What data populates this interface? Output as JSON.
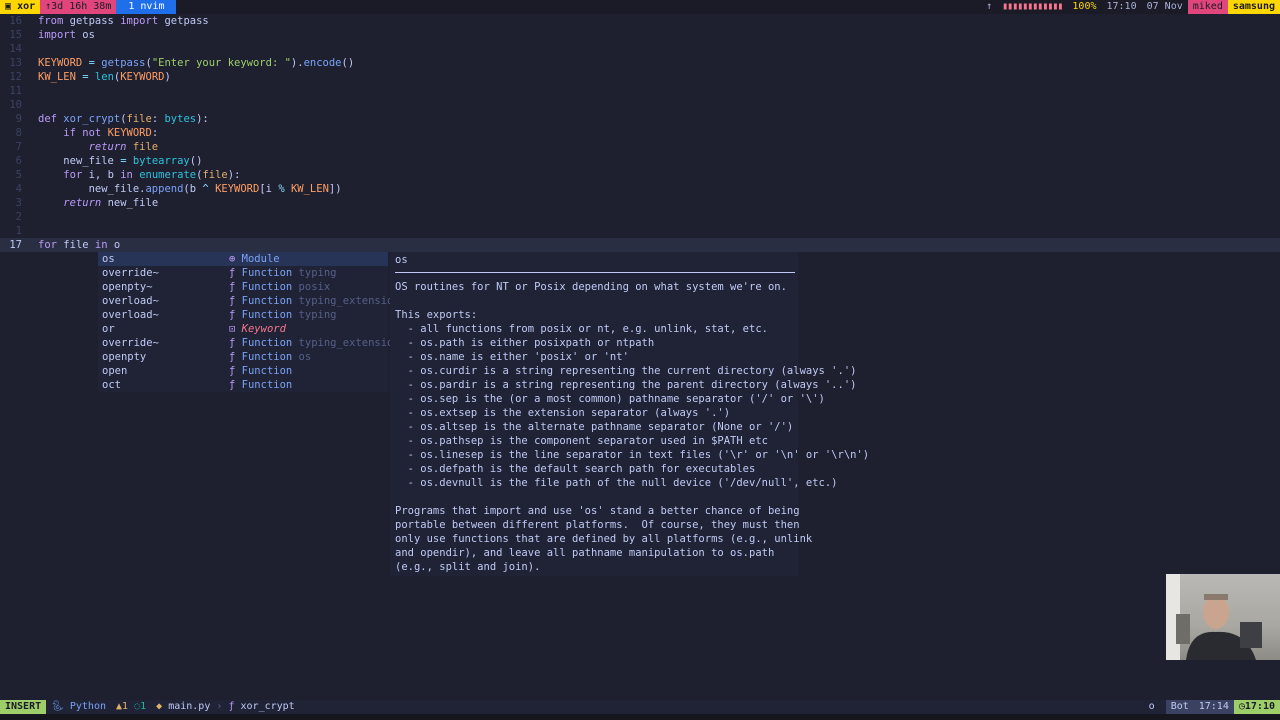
{
  "topbar": {
    "session": "xor",
    "uptime": "↑3d 16h 38m",
    "window": "1 nvim",
    "battery_arrow": "↑",
    "battery_bars": "▮▮▮▮▮▮▮▮▮▮▮▮",
    "battery_pct": "100%",
    "time": "17:10",
    "date": "07 Nov",
    "user": "miked",
    "host": "samsung",
    "colors": {
      "session_bg": "#ffd700",
      "uptime_bg": "#e0457b",
      "window_bg": "#1f6feb",
      "user_bg": "#e0457b",
      "host_bg": "#ffd700"
    }
  },
  "editor": {
    "lines": [
      {
        "num": "16",
        "html": "<span class='kw'>from</span> <span class='var'>getpass</span> <span class='kw'>import</span> <span class='var'>getpass</span>"
      },
      {
        "num": "15",
        "html": "<span class='kw'>import</span> <span class='var'>os</span>"
      },
      {
        "num": "14",
        "html": ""
      },
      {
        "num": "13",
        "html": "<span class='const'>KEYWORD</span> <span class='op'>=</span> <span class='fn'>getpass</span>(<span class='str'>\"Enter your keyword: \"</span>).<span class='fn'>encode</span>()"
      },
      {
        "num": "12",
        "html": "<span class='const'>KW_LEN</span> <span class='op'>=</span> <span class='ty'>len</span>(<span class='const'>KEYWORD</span>)"
      },
      {
        "num": "11",
        "html": ""
      },
      {
        "num": "10",
        "html": ""
      },
      {
        "num": "9",
        "html": "<span class='kw'>def</span> <span class='fn'>xor_crypt</span>(<span class='param'>file</span>: <span class='ty'>bytes</span>):"
      },
      {
        "num": "8",
        "html": "    <span class='kw'>if</span> <span class='kw'>not</span> <span class='const'>KEYWORD</span>:"
      },
      {
        "num": "7",
        "html": "        <span class='kwi'>return</span> <span class='param'>file</span>"
      },
      {
        "num": "6",
        "html": "    <span class='var'>new_file</span> <span class='op'>=</span> <span class='ty'>bytearray</span>()"
      },
      {
        "num": "5",
        "html": "    <span class='kw'>for</span> <span class='var'>i</span>, <span class='var'>b</span> <span class='kw'>in</span> <span class='ty'>enumerate</span>(<span class='param'>file</span>):"
      },
      {
        "num": "4",
        "html": "        <span class='var'>new_file</span>.<span class='fn'>append</span>(<span class='var'>b</span> <span class='op'>^</span> <span class='const'>KEYWORD</span>[<span class='var'>i</span> <span class='op'>%</span> <span class='const'>KW_LEN</span>])"
      },
      {
        "num": "3",
        "html": "    <span class='kwi'>return</span> <span class='var'>new_file</span>"
      },
      {
        "num": "2",
        "html": ""
      },
      {
        "num": "1",
        "html": ""
      },
      {
        "num": "17",
        "html": "<span class='kw'>for</span> <span class='var'>file</span> <span class='kw'>in</span> <span class='var'>o</span>",
        "current": true
      }
    ]
  },
  "completion": {
    "items": [
      {
        "word": "os",
        "icon": "⊕",
        "kind": "Module",
        "source": "",
        "selected": true
      },
      {
        "word": "override~",
        "icon": "ƒ",
        "kind": "Function",
        "source": "typing"
      },
      {
        "word": "openpty~",
        "icon": "ƒ",
        "kind": "Function",
        "source": "posix"
      },
      {
        "word": "overload~",
        "icon": "ƒ",
        "kind": "Function",
        "source": "typing_extensions"
      },
      {
        "word": "overload~",
        "icon": "ƒ",
        "kind": "Function",
        "source": "typing"
      },
      {
        "word": "or",
        "icon": "⊡",
        "kind": "Keyword",
        "source": "",
        "keyword": true
      },
      {
        "word": "override~",
        "icon": "ƒ",
        "kind": "Function",
        "source": "typing_extensions"
      },
      {
        "word": "openpty",
        "icon": "ƒ",
        "kind": "Function",
        "source": "os"
      },
      {
        "word": "open",
        "icon": "ƒ",
        "kind": "Function",
        "source": ""
      },
      {
        "word": "oct",
        "icon": "ƒ",
        "kind": "Function",
        "source": ""
      }
    ]
  },
  "docs": {
    "title": "os",
    "body": "OS routines for NT or Posix depending on what system we're on.\n\nThis exports:\n  - all functions from posix or nt, e.g. unlink, stat, etc.\n  - os.path is either posixpath or ntpath\n  - os.name is either 'posix' or 'nt'\n  - os.curdir is a string representing the current directory (always '.')\n  - os.pardir is a string representing the parent directory (always '..')\n  - os.sep is the (or a most common) pathname separator ('/' or '\\')\n  - os.extsep is the extension separator (always '.')\n  - os.altsep is the alternate pathname separator (None or '/')\n  - os.pathsep is the component separator used in $PATH etc\n  - os.linesep is the line separator in text files ('\\r' or '\\n' or '\\r\\n')\n  - os.defpath is the default search path for executables\n  - os.devnull is the file path of the null device ('/dev/null', etc.)\n\nPrograms that import and use 'os' stand a better chance of being\nportable between different platforms.  Of course, they must then\nonly use functions that are defined by all platforms (e.g., unlink\nand opendir), and leave all pathname manipulation to os.path\n(e.g., split and join)."
  },
  "status": {
    "mode": "INSERT",
    "filetype": "Python",
    "warnings": "1",
    "hints": "1",
    "filename": "main.py",
    "symbol": "xor_crypt",
    "right_o": "o",
    "position": "Bot",
    "cursor_time": "17:14",
    "clock": "17:10"
  }
}
